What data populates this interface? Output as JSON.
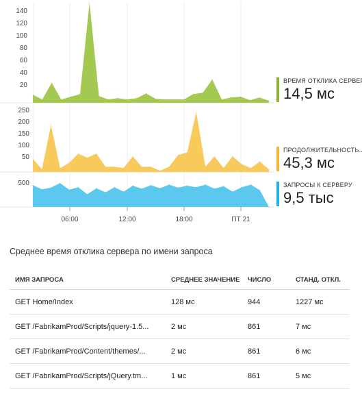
{
  "chart_data": [
    {
      "type": "area",
      "color": "#a4c952",
      "ylim": [
        0,
        150
      ],
      "yticks": [
        "20",
        "40",
        "60",
        "80",
        "100",
        "120",
        "140"
      ],
      "values": [
        12,
        5,
        30,
        5,
        9,
        13,
        150,
        10,
        5,
        7,
        5,
        7,
        14,
        6,
        5,
        5,
        5,
        13,
        15,
        35,
        5,
        8,
        9,
        4,
        8,
        3
      ]
    },
    {
      "type": "area",
      "color": "#f8c95b",
      "ylim": [
        0,
        260
      ],
      "yticks": [
        "50",
        "100",
        "150",
        "200",
        "250"
      ],
      "values": [
        50,
        10,
        180,
        15,
        35,
        70,
        55,
        70,
        20,
        20,
        15,
        60,
        20,
        20,
        5,
        20,
        65,
        75,
        230,
        20,
        60,
        15,
        60,
        30,
        15,
        40,
        10
      ]
    },
    {
      "type": "area",
      "color": "#5bc8ee",
      "ylim": [
        0,
        650
      ],
      "yticks": [
        "500"
      ],
      "x_ticks": [
        "06:00",
        "12:00",
        "18:00",
        "ПТ 21"
      ],
      "values": [
        430,
        350,
        380,
        470,
        340,
        390,
        250,
        370,
        290,
        390,
        300,
        420,
        360,
        430,
        370,
        440,
        380,
        420,
        390,
        440,
        360,
        410,
        300,
        390,
        440,
        330,
        0
      ]
    }
  ],
  "legend": [
    {
      "label": "ВРЕМЯ ОТКЛИКА СЕРВЕРА",
      "value": "14,5 мс",
      "color": "#8cb32f"
    },
    {
      "label": "ПРОДОЛЖИТЕЛЬНОСТЬ...",
      "value": "45,3 мс",
      "color": "#f2b83c"
    },
    {
      "label": "ЗАПРОСЫ К СЕРВЕРУ",
      "value": "9,5 тыс",
      "color": "#1fb2e3"
    }
  ],
  "table": {
    "title": "Среднее время отклика сервера по имени запроса",
    "headers": [
      "ИМЯ ЗАПРОСА",
      "СРЕДНЕЕ ЗНАЧЕНИЕ",
      "ЧИСЛО",
      "СТАНД. ОТКЛ."
    ],
    "rows": [
      {
        "name": "GET Home/Index",
        "avg": "128 мс",
        "count": "944",
        "std": "1227 мс"
      },
      {
        "name": "GET /FabrikamProd/Scripts/jquery-1.5...",
        "avg": "2 мс",
        "count": "861",
        "std": "7 мс"
      },
      {
        "name": "GET /FabrikamProd/Content/themes/...",
        "avg": "2 мс",
        "count": "861",
        "std": "6 мс"
      },
      {
        "name": "GET /FabrikamProd/Scripts/jQuery.tm...",
        "avg": "1 мс",
        "count": "861",
        "std": "5 мс"
      }
    ]
  }
}
